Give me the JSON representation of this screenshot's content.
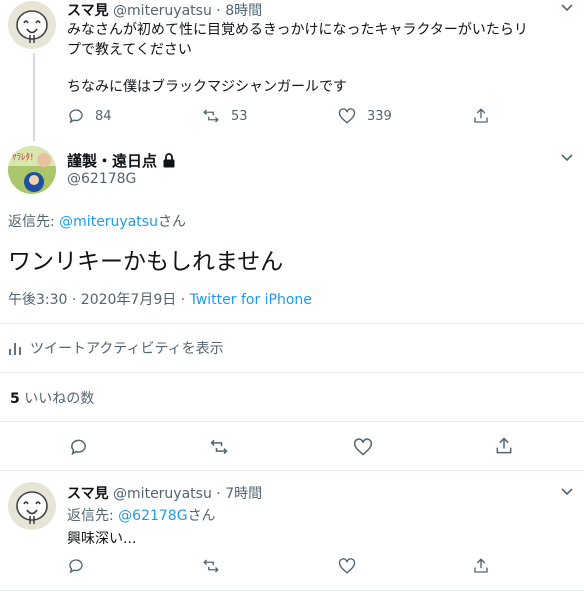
{
  "tweet1": {
    "author": "スマ見",
    "handle": "@miteruyatsu",
    "dot": "·",
    "time": "8時間",
    "text1": "みなさんが初めて性に目覚めるきっかけになったキャラクターがいたらリ",
    "text2": "プで教えてください",
    "text3": "ちなみに僕はブラックマジシャンガールです",
    "replies": "84",
    "retweets": "53",
    "likes": "339"
  },
  "main": {
    "author": "謹製・遠日点",
    "handle": "@62178G",
    "reply_prefix": "返信先: ",
    "reply_to": "@miteruyatsu",
    "reply_suffix": "さん",
    "text": "ワンリキーかもしれません",
    "time": "午後3:30 · 2020年7月9日",
    "sep": " · ",
    "client": "Twitter for iPhone",
    "activity": "ツイートアクティビティを表示",
    "likes_count": "5",
    "likes_label": "いいねの数"
  },
  "tweet3": {
    "author": "スマ見",
    "handle": "@miteruyatsu",
    "dot": "·",
    "time": "7時間",
    "reply_prefix": "返信先: ",
    "reply_to": "@62178G",
    "reply_suffix": "さん",
    "text": "興味深い..."
  },
  "colors": {
    "accent": "#1d9bf0",
    "muted": "#536471",
    "border": "#e6ecf0"
  }
}
